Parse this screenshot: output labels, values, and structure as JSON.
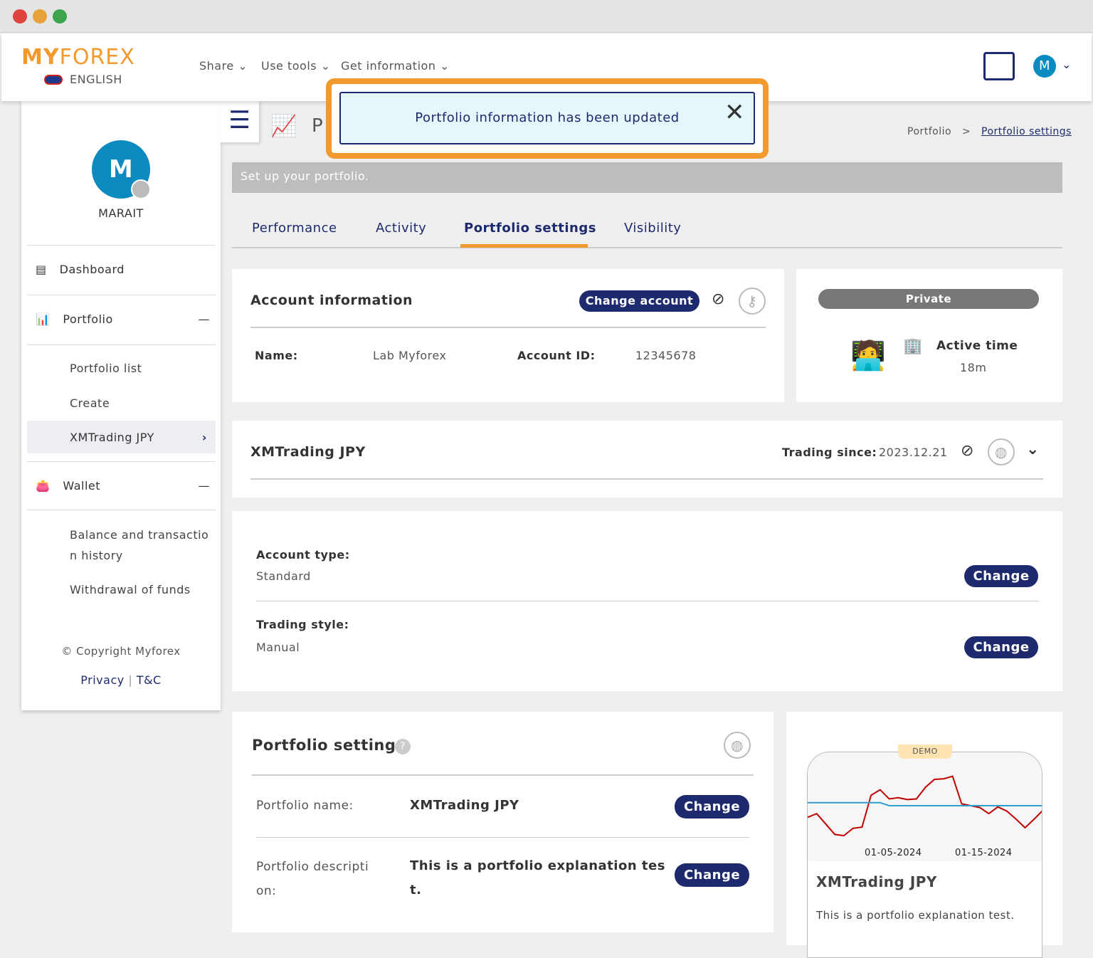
{
  "header": {
    "logo": "MYFOREX",
    "language": "ENGLISH",
    "nav": [
      "Share",
      "Use tools",
      "Get information"
    ],
    "user_initial": "M"
  },
  "toast": {
    "message": "Portfolio information has been updated"
  },
  "sidebar": {
    "avatar_initial": "M",
    "username": "MARAIT",
    "items": {
      "dashboard": "Dashboard",
      "portfolio": "Portfolio",
      "portfolio_list": "Portfolio list",
      "create": "Create",
      "xmtrading": "XMTrading JPY",
      "wallet": "Wallet",
      "balance": "Balance and transactio",
      "balance2": "n history",
      "withdrawal": "Withdrawal of funds"
    },
    "copyright": "© Copyright Myforex",
    "privacy": "Privacy",
    "sep": "|",
    "tc": "T&C"
  },
  "page": {
    "title_initial": "P",
    "breadcrumb": [
      "Portfolio",
      ">",
      "Portfolio settings"
    ],
    "banner": "Set up your portfolio.",
    "tabs": [
      "Performance",
      "Activity",
      "Portfolio settings",
      "Visibility"
    ],
    "active_tab": 2
  },
  "account": {
    "title": "Account information",
    "change_account": "Change account",
    "name_label": "Name:",
    "name": "Lab Myforex",
    "id_label": "Account ID:",
    "id": "12345678"
  },
  "status": {
    "visibility": "Private",
    "active_label": "Active time",
    "active_value": "18m"
  },
  "xm": {
    "title": "XMTrading JPY",
    "since_label": "Trading since:",
    "since": "2023.12.21"
  },
  "details": {
    "type_label": "Account type:",
    "type": "Standard",
    "style_label": "Trading style:",
    "style": "Manual",
    "change": "Change"
  },
  "settings": {
    "title": "Portfolio settings",
    "name_label": "Portfolio name:",
    "name": "XMTrading JPY",
    "desc_label1": "Portfolio descripti",
    "desc_label2": "on:",
    "desc1": "This is a portfolio explanation tes",
    "desc2": "t.",
    "change": "Change"
  },
  "preview": {
    "badge": "DEMO",
    "title": "XMTrading JPY",
    "desc": "This is a portfolio explanation test."
  },
  "chart_data": {
    "type": "line",
    "x_ticks": [
      "01-05-2024",
      "01-15-2024"
    ],
    "series": [
      {
        "color": "#c00000",
        "values": [
          31,
          37,
          20,
          3,
          1,
          13,
          15,
          67,
          76,
          61,
          63,
          60,
          61,
          80,
          93,
          94,
          98,
          53,
          50,
          47,
          37,
          48,
          41,
          28,
          14,
          28,
          43
        ]
      },
      {
        "color": "#2a9fd0",
        "values": [
          55,
          55,
          55,
          55,
          55,
          55,
          55,
          55,
          55,
          50,
          50,
          50,
          50,
          50,
          50,
          50,
          50,
          50,
          50,
          50,
          50,
          50,
          50,
          50,
          50,
          50,
          50
        ]
      }
    ]
  }
}
